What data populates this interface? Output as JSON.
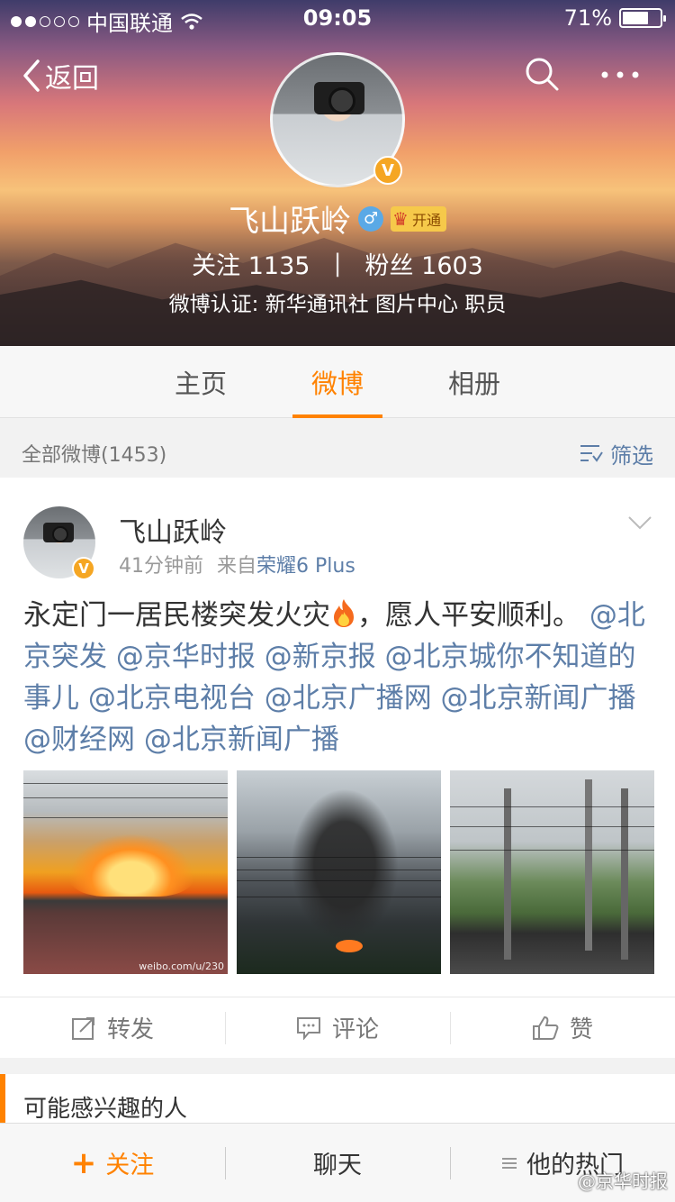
{
  "status_bar": {
    "carrier": "中国联通",
    "time": "09:05",
    "battery": "71%",
    "battery_level": 0.71,
    "signal_bars": 2
  },
  "header": {
    "back_label": "返回",
    "name": "飞山跃岭",
    "gender": "♂",
    "vip_label": "开通",
    "v_badge": "V",
    "follow_label": "关注",
    "follow_count": "1135",
    "separator": "|",
    "fans_label": "粉丝",
    "fans_count": "1603",
    "verification": "微博认证: 新华通讯社 图片中心 职员"
  },
  "tabs": [
    {
      "label": "主页",
      "active": false
    },
    {
      "label": "微博",
      "active": true
    },
    {
      "label": "相册",
      "active": false
    }
  ],
  "filter_bar": {
    "count_label": "全部微博(1453)",
    "filter_label": "筛选"
  },
  "post": {
    "author": "飞山跃岭",
    "v_badge": "V",
    "time": "41分钟前",
    "source_prefix": "来自",
    "source": "荣耀6 Plus",
    "text": "永定门一居民楼突发火灾",
    "text_suffix": "，愿人平安顺利。",
    "mentions": "@北京突发 @京华时报 @新京报 @北京城你不知道的事儿 @北京电视台 @北京广播网 @北京新闻广播 @财经网 @北京新闻广播",
    "photo_watermark": "weibo.com/u/230",
    "photos": [
      "fire-roof",
      "smoke-wires",
      "smoke-utility-pole"
    ],
    "actions": {
      "repost": "转发",
      "comment": "评论",
      "like": "赞"
    }
  },
  "suggest": {
    "title": "可能感兴趣的人"
  },
  "bottom_bar": {
    "follow": "关注",
    "chat": "聊天",
    "hot": "他的热门"
  },
  "corner_watermark": "@京华时报",
  "colors": {
    "accent": "#ff8200",
    "link": "#5d7ea8",
    "v_badge": "#f5a623",
    "gender": "#5aa9e6"
  }
}
